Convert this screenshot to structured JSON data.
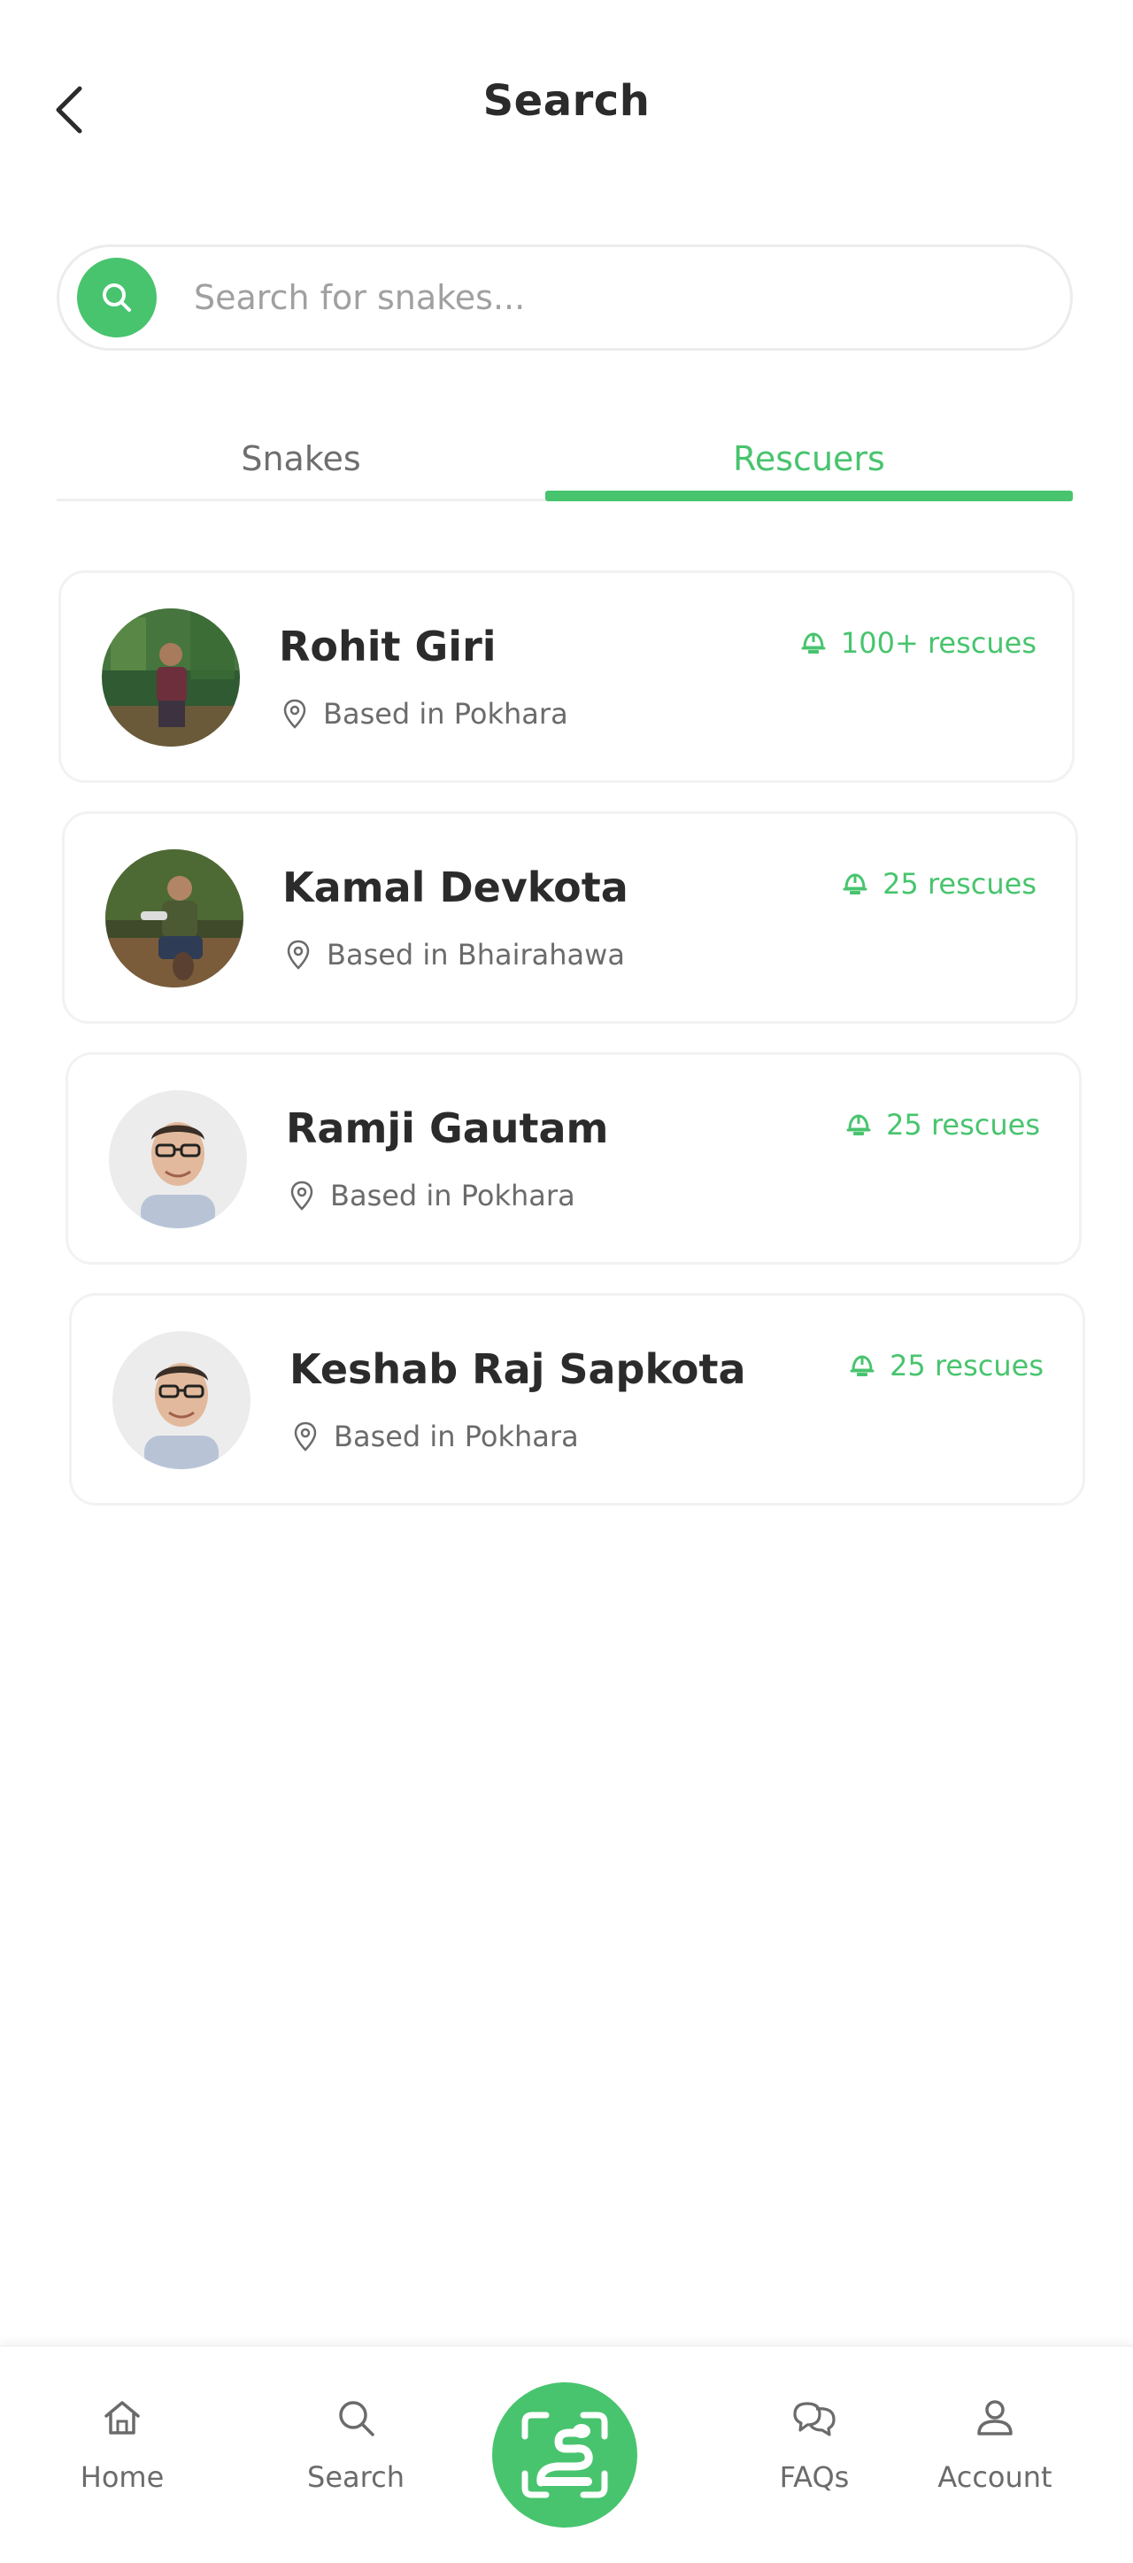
{
  "header": {
    "title": "Search"
  },
  "search": {
    "placeholder": "Search for snakes..."
  },
  "tabs": [
    {
      "label": "Snakes",
      "active": false
    },
    {
      "label": "Rescuers",
      "active": true
    }
  ],
  "rescuers": [
    {
      "name": "Rohit Giri",
      "location": "Based in Pokhara",
      "rescues": "100+ rescues",
      "avatar": "forest-photo"
    },
    {
      "name": "Kamal Devkota",
      "location": "Based in Bhairahawa",
      "rescues": "25 rescues",
      "avatar": "field-photo"
    },
    {
      "name": "Ramji Gautam",
      "location": "Based in Pokhara",
      "rescues": "25 rescues",
      "avatar": "portrait-photo"
    },
    {
      "name": "Keshab Raj Sapkota",
      "location": "Based in Pokhara",
      "rescues": "25 rescues",
      "avatar": "portrait-photo"
    }
  ],
  "nav": {
    "home": "Home",
    "search": "Search",
    "faqs": "FAQs",
    "account": "Account"
  },
  "colors": {
    "accent": "#48c46e",
    "text": "#2b2b2b",
    "muted": "#6b6b6b"
  }
}
